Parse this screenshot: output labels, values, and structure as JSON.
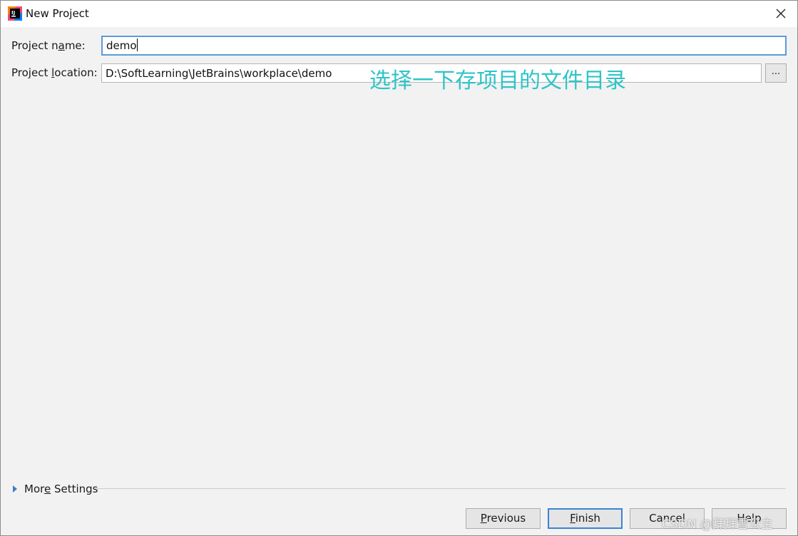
{
  "window": {
    "title": "New Project",
    "icon": "intellij-idea-icon",
    "close_icon": "close-icon"
  },
  "form": {
    "name_label_pre": "Project n",
    "name_label_u": "a",
    "name_label_post": "me:",
    "name_value": "demo",
    "location_label_pre": "Project ",
    "location_label_u": "l",
    "location_label_post": "ocation:",
    "location_value": "D:\\SoftLearning\\JetBrains\\workplace\\demo",
    "browse_label": "..."
  },
  "annotation": "选择一下存项目的文件目录",
  "more_settings": {
    "pre": "Mor",
    "u": "e",
    "post": " Settings"
  },
  "buttons": {
    "previous_u": "P",
    "previous_rest": "revious",
    "finish_u": "F",
    "finish_rest": "inish",
    "cancel": "Cancel",
    "help": "Help"
  },
  "watermark": "CSDN @拜拜雪公主",
  "colors": {
    "accent": "#3a84d4",
    "annotation": "#2ec4c8",
    "background": "#f2f2f2"
  }
}
